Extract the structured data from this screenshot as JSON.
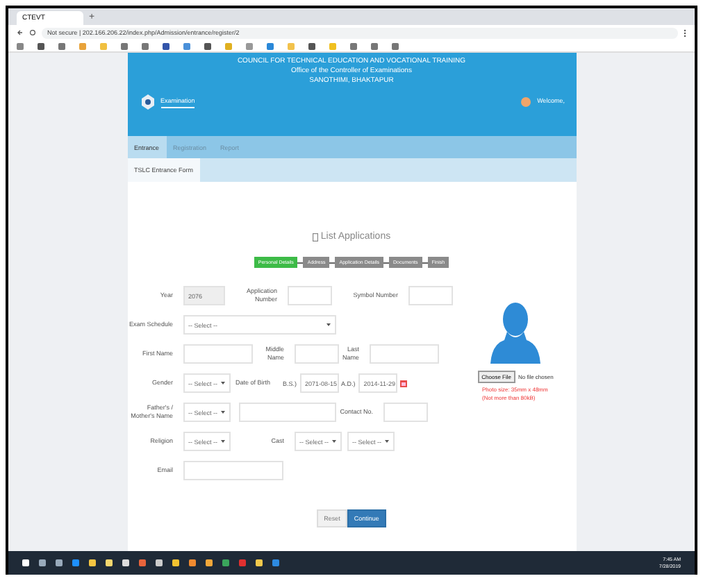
{
  "browser": {
    "tab_title": "CTEVT",
    "new_tab": "+",
    "url": "Not secure | 202.166.206.22/index.php/Admission/entrance/register/2"
  },
  "header": {
    "title_lines": [
      "COUNCIL FOR TECHNICAL EDUCATION AND VOCATIONAL TRAINING",
      "Office of the Controller of Examinations",
      "SANOTHIMI, BHAKTAPUR"
    ],
    "brand": "Examination",
    "welcome": "Welcome,"
  },
  "nav": [
    {
      "label": "Entrance",
      "selected": true
    },
    {
      "label": "Registration",
      "selected": false
    },
    {
      "label": "Report",
      "selected": false
    }
  ],
  "subnav": [
    {
      "label": "TSLC Entrance Form",
      "selected": true
    }
  ],
  "page_title": "List Applications",
  "steps": [
    {
      "label": "Personal Details",
      "selected": true
    },
    {
      "label": "Address",
      "selected": false
    },
    {
      "label": "Application Details",
      "selected": false
    },
    {
      "label": "Documents",
      "selected": false
    },
    {
      "label": "Finish",
      "selected": false
    }
  ],
  "form": {
    "year_label": "Year",
    "year_value": "2076",
    "application_label": "Application Number",
    "symbol_label": "Symbol Number",
    "exam_label": "Exam Schedule",
    "exam_value": "-- Select --",
    "first_label": "First Name",
    "middle_label": "Middle Name",
    "last_label": "Last Name",
    "gender_label": "Gender",
    "gender_value": "-- Select --",
    "dob_label": "Date of Birth",
    "bs_label": "B.S.)",
    "bs_value": "2071-08-15",
    "ad_label": "A.D.)",
    "ad_value": "2014-11-29",
    "parent_label": "Father's / Mother's Name",
    "parent_value": "-- Select --",
    "contact_label": "Contact No.",
    "religion_label": "Religion",
    "religion_value": "-- Select --",
    "cast_label": "Cast",
    "cast_value_1": "-- Select --",
    "cast_value_2": "-- Select --",
    "email_label": "Email"
  },
  "photo": {
    "choose_file": "Choose File",
    "no_file": "No file chosen",
    "note": "Photo size: 35mm x 48mm (Not more than 80kB)"
  },
  "buttons": {
    "reset": "Reset",
    "continue": "Continue"
  },
  "taskbar": {
    "time": "7:45 AM",
    "date": "7/28/2019"
  }
}
